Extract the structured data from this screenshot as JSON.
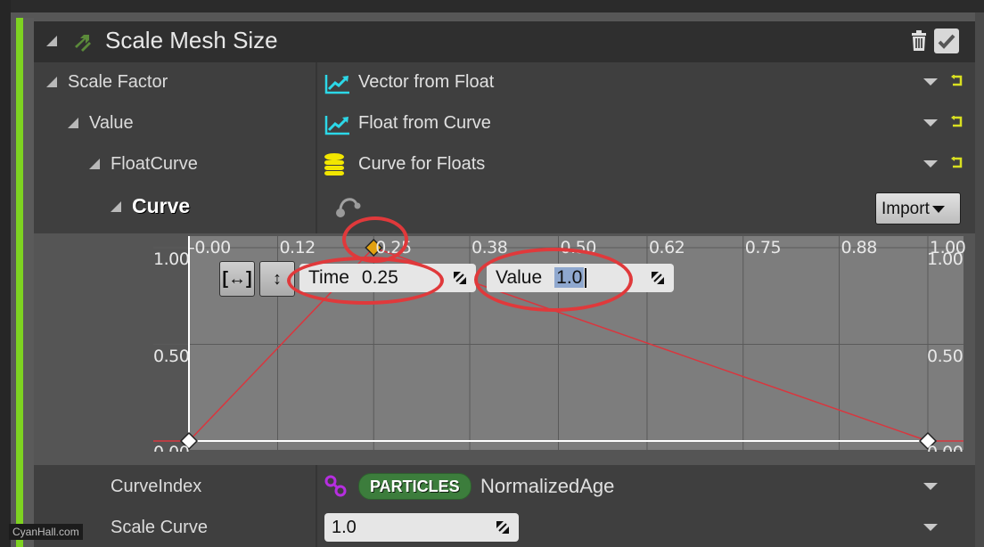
{
  "module": {
    "title": "Scale Mesh Size",
    "enabled": true,
    "accent_color": "#7ed321"
  },
  "rows": [
    {
      "label": "Scale Factor",
      "value": "Vector from Float",
      "icon": "dynamic-input-icon"
    },
    {
      "label": "Value",
      "value": "Float from Curve",
      "icon": "dynamic-input-icon"
    },
    {
      "label": "FloatCurve",
      "value": "Curve for Floats",
      "icon": "data-stack-icon"
    },
    {
      "label": "Curve",
      "value": "",
      "icon": "curve-editor-icon"
    }
  ],
  "import_button": {
    "label": "Import"
  },
  "curve_editor": {
    "key_time_label": "Time",
    "key_time_value": "0.25",
    "key_value_label": "Value",
    "key_value_value": "1.0",
    "x_ticks": [
      "-0.00",
      "0.12",
      "0.25",
      "0.38",
      "0.50",
      "0.62",
      "0.75",
      "0.88",
      "1.00"
    ],
    "y_ticks_left": [
      "1.00",
      "0.50",
      "0.00"
    ],
    "y_ticks_right": [
      "1.00",
      "0.50",
      "0.00"
    ],
    "top_right_overlap_label": "1.00"
  },
  "chart_data": {
    "type": "line",
    "title": "",
    "xlabel": "Time",
    "ylabel": "Value",
    "x": [
      0.0,
      0.25,
      1.0
    ],
    "series": [
      {
        "name": "Curve",
        "values": [
          0.0,
          1.0,
          0.0
        ],
        "color": "#d9363e"
      }
    ],
    "selected_key_index": 1,
    "xlim": [
      0.0,
      1.0
    ],
    "ylim": [
      0.0,
      1.0
    ],
    "x_ticks": [
      0.0,
      0.12,
      0.25,
      0.38,
      0.5,
      0.62,
      0.75,
      0.88,
      1.0
    ],
    "y_ticks": [
      0.0,
      0.5,
      1.0
    ],
    "grid": true
  },
  "curve_index": {
    "label": "CurveIndex",
    "namespace_badge": "PARTICLES",
    "value": "NormalizedAge"
  },
  "scale_curve": {
    "label": "Scale Curve",
    "value": "1.0"
  },
  "watermark": "CyanHall.com"
}
